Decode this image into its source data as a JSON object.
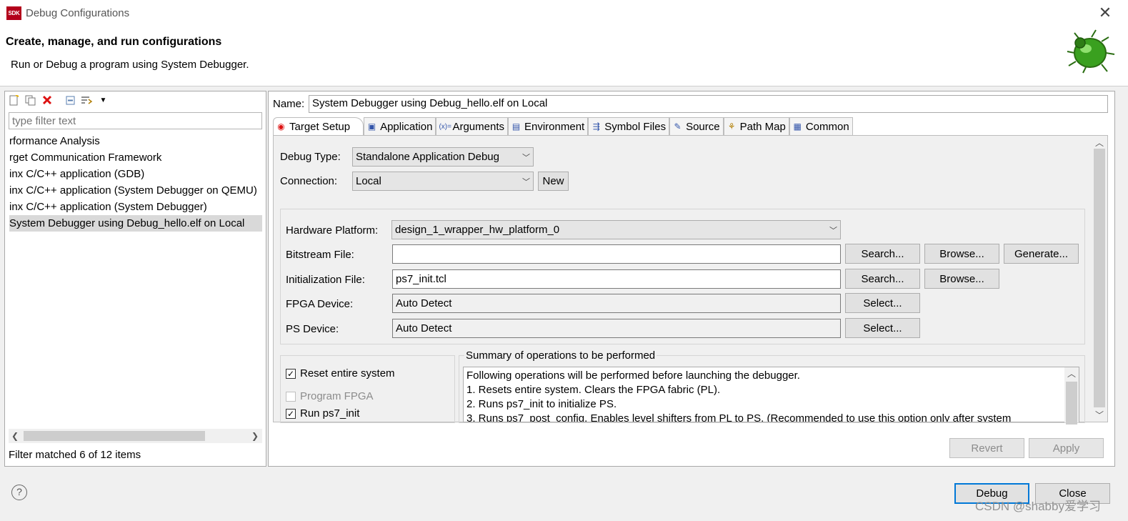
{
  "window": {
    "logo_text": "SDK",
    "title": "Debug Configurations",
    "close_glyph": "✕"
  },
  "header": {
    "title": "Create, manage, and run configurations",
    "subtitle": "Run or Debug a program using System Debugger."
  },
  "left": {
    "filter_placeholder": "type filter text",
    "items": [
      "rformance Analysis",
      "rget Communication Framework",
      "inx C/C++ application (GDB)",
      "inx C/C++ application (System Debugger on QEMU)",
      "inx C/C++ application (System Debugger)",
      "System Debugger using Debug_hello.elf on Local"
    ],
    "selected_index": 5,
    "status": "Filter matched 6 of 12 items"
  },
  "right": {
    "name_label": "Name:",
    "name_value": "System Debugger using Debug_hello.elf on Local",
    "tabs": [
      {
        "label": "Target Setup",
        "icon": "target-icon"
      },
      {
        "label": "Application",
        "icon": "application-icon"
      },
      {
        "label": "Arguments",
        "icon": "arguments-icon"
      },
      {
        "label": "Environment",
        "icon": "environment-icon"
      },
      {
        "label": "Symbol Files",
        "icon": "symbol-files-icon"
      },
      {
        "label": "Source",
        "icon": "source-icon"
      },
      {
        "label": "Path Map",
        "icon": "path-map-icon"
      },
      {
        "label": "Common",
        "icon": "common-icon"
      }
    ],
    "debug_type_label": "Debug Type:",
    "debug_type_value": "Standalone Application Debug",
    "connection_label": "Connection:",
    "connection_value": "Local",
    "new_button": "New",
    "hw_platform_label": "Hardware Platform:",
    "hw_platform_value": "design_1_wrapper_hw_platform_0",
    "bitstream_label": "Bitstream File:",
    "bitstream_value": "",
    "init_label": "Initialization File:",
    "init_value": "ps7_init.tcl",
    "fpga_label": "FPGA Device:",
    "fpga_value": "Auto Detect",
    "ps_label": "PS Device:",
    "ps_value": "Auto Detect",
    "search_button": "Search...",
    "browse_button": "Browse...",
    "generate_button": "Generate...",
    "select_button": "Select...",
    "options": [
      {
        "label": "Reset entire system",
        "checked": true,
        "enabled": true
      },
      {
        "label": "Program FPGA",
        "checked": false,
        "enabled": false
      },
      {
        "label": "Run ps7_init",
        "checked": true,
        "enabled": true
      }
    ],
    "summary_title": "Summary of operations to be performed",
    "summary_lines": [
      "Following operations will be performed before launching the debugger.",
      "1. Resets entire system. Clears the FPGA fabric (PL).",
      "2. Runs ps7_init to initialize PS.",
      "3. Runs ps7_post_config. Enables level shifters from PL to PS. (Recommended to use this option only after system"
    ],
    "revert_button": "Revert",
    "apply_button": "Apply"
  },
  "footer": {
    "help_glyph": "?",
    "debug_button": "Debug",
    "close_button": "Close",
    "watermark": "CSDN @shabby爱学习"
  },
  "colors": {
    "accent": "#0078d7",
    "logo_bg": "#b3001b",
    "delete_red": "#d11"
  }
}
